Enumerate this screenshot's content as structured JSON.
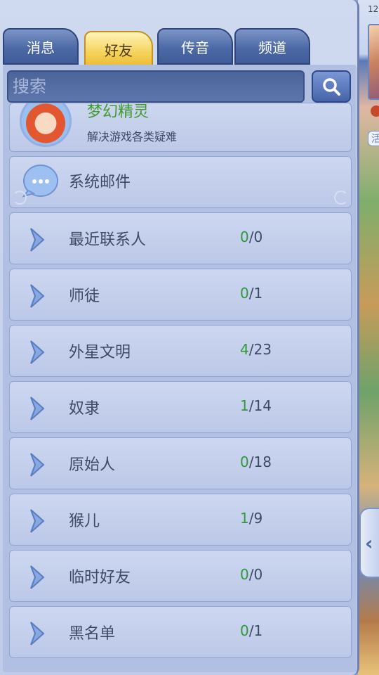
{
  "tabs": [
    {
      "label": "消息"
    },
    {
      "label": "好友"
    },
    {
      "label": "传音"
    },
    {
      "label": "频道"
    }
  ],
  "active_tab": "好友",
  "search": {
    "placeholder": "搜索"
  },
  "helper": {
    "name": "梦幻精灵",
    "desc": "解决游戏各类疑难"
  },
  "mail": {
    "label": "系统邮件"
  },
  "groups": [
    {
      "label": "最近联系人",
      "online": "0",
      "total": "/0"
    },
    {
      "label": "师徒",
      "online": "0",
      "total": "/1"
    },
    {
      "label": "外星文明",
      "online": "4",
      "total": "/23"
    },
    {
      "label": "奴隶",
      "online": "1",
      "total": "/14"
    },
    {
      "label": "原始人",
      "online": "0",
      "total": "/18"
    },
    {
      "label": "猴儿",
      "online": "1",
      "total": "/9"
    },
    {
      "label": "临时好友",
      "online": "0",
      "total": "/0"
    },
    {
      "label": "黑名单",
      "online": "0",
      "total": "/1"
    }
  ],
  "scene": {
    "time": "12"
  },
  "colors": {
    "online": "#2f9a38",
    "tab_active": "#f5d35a",
    "tab": "#4d6aa6"
  }
}
